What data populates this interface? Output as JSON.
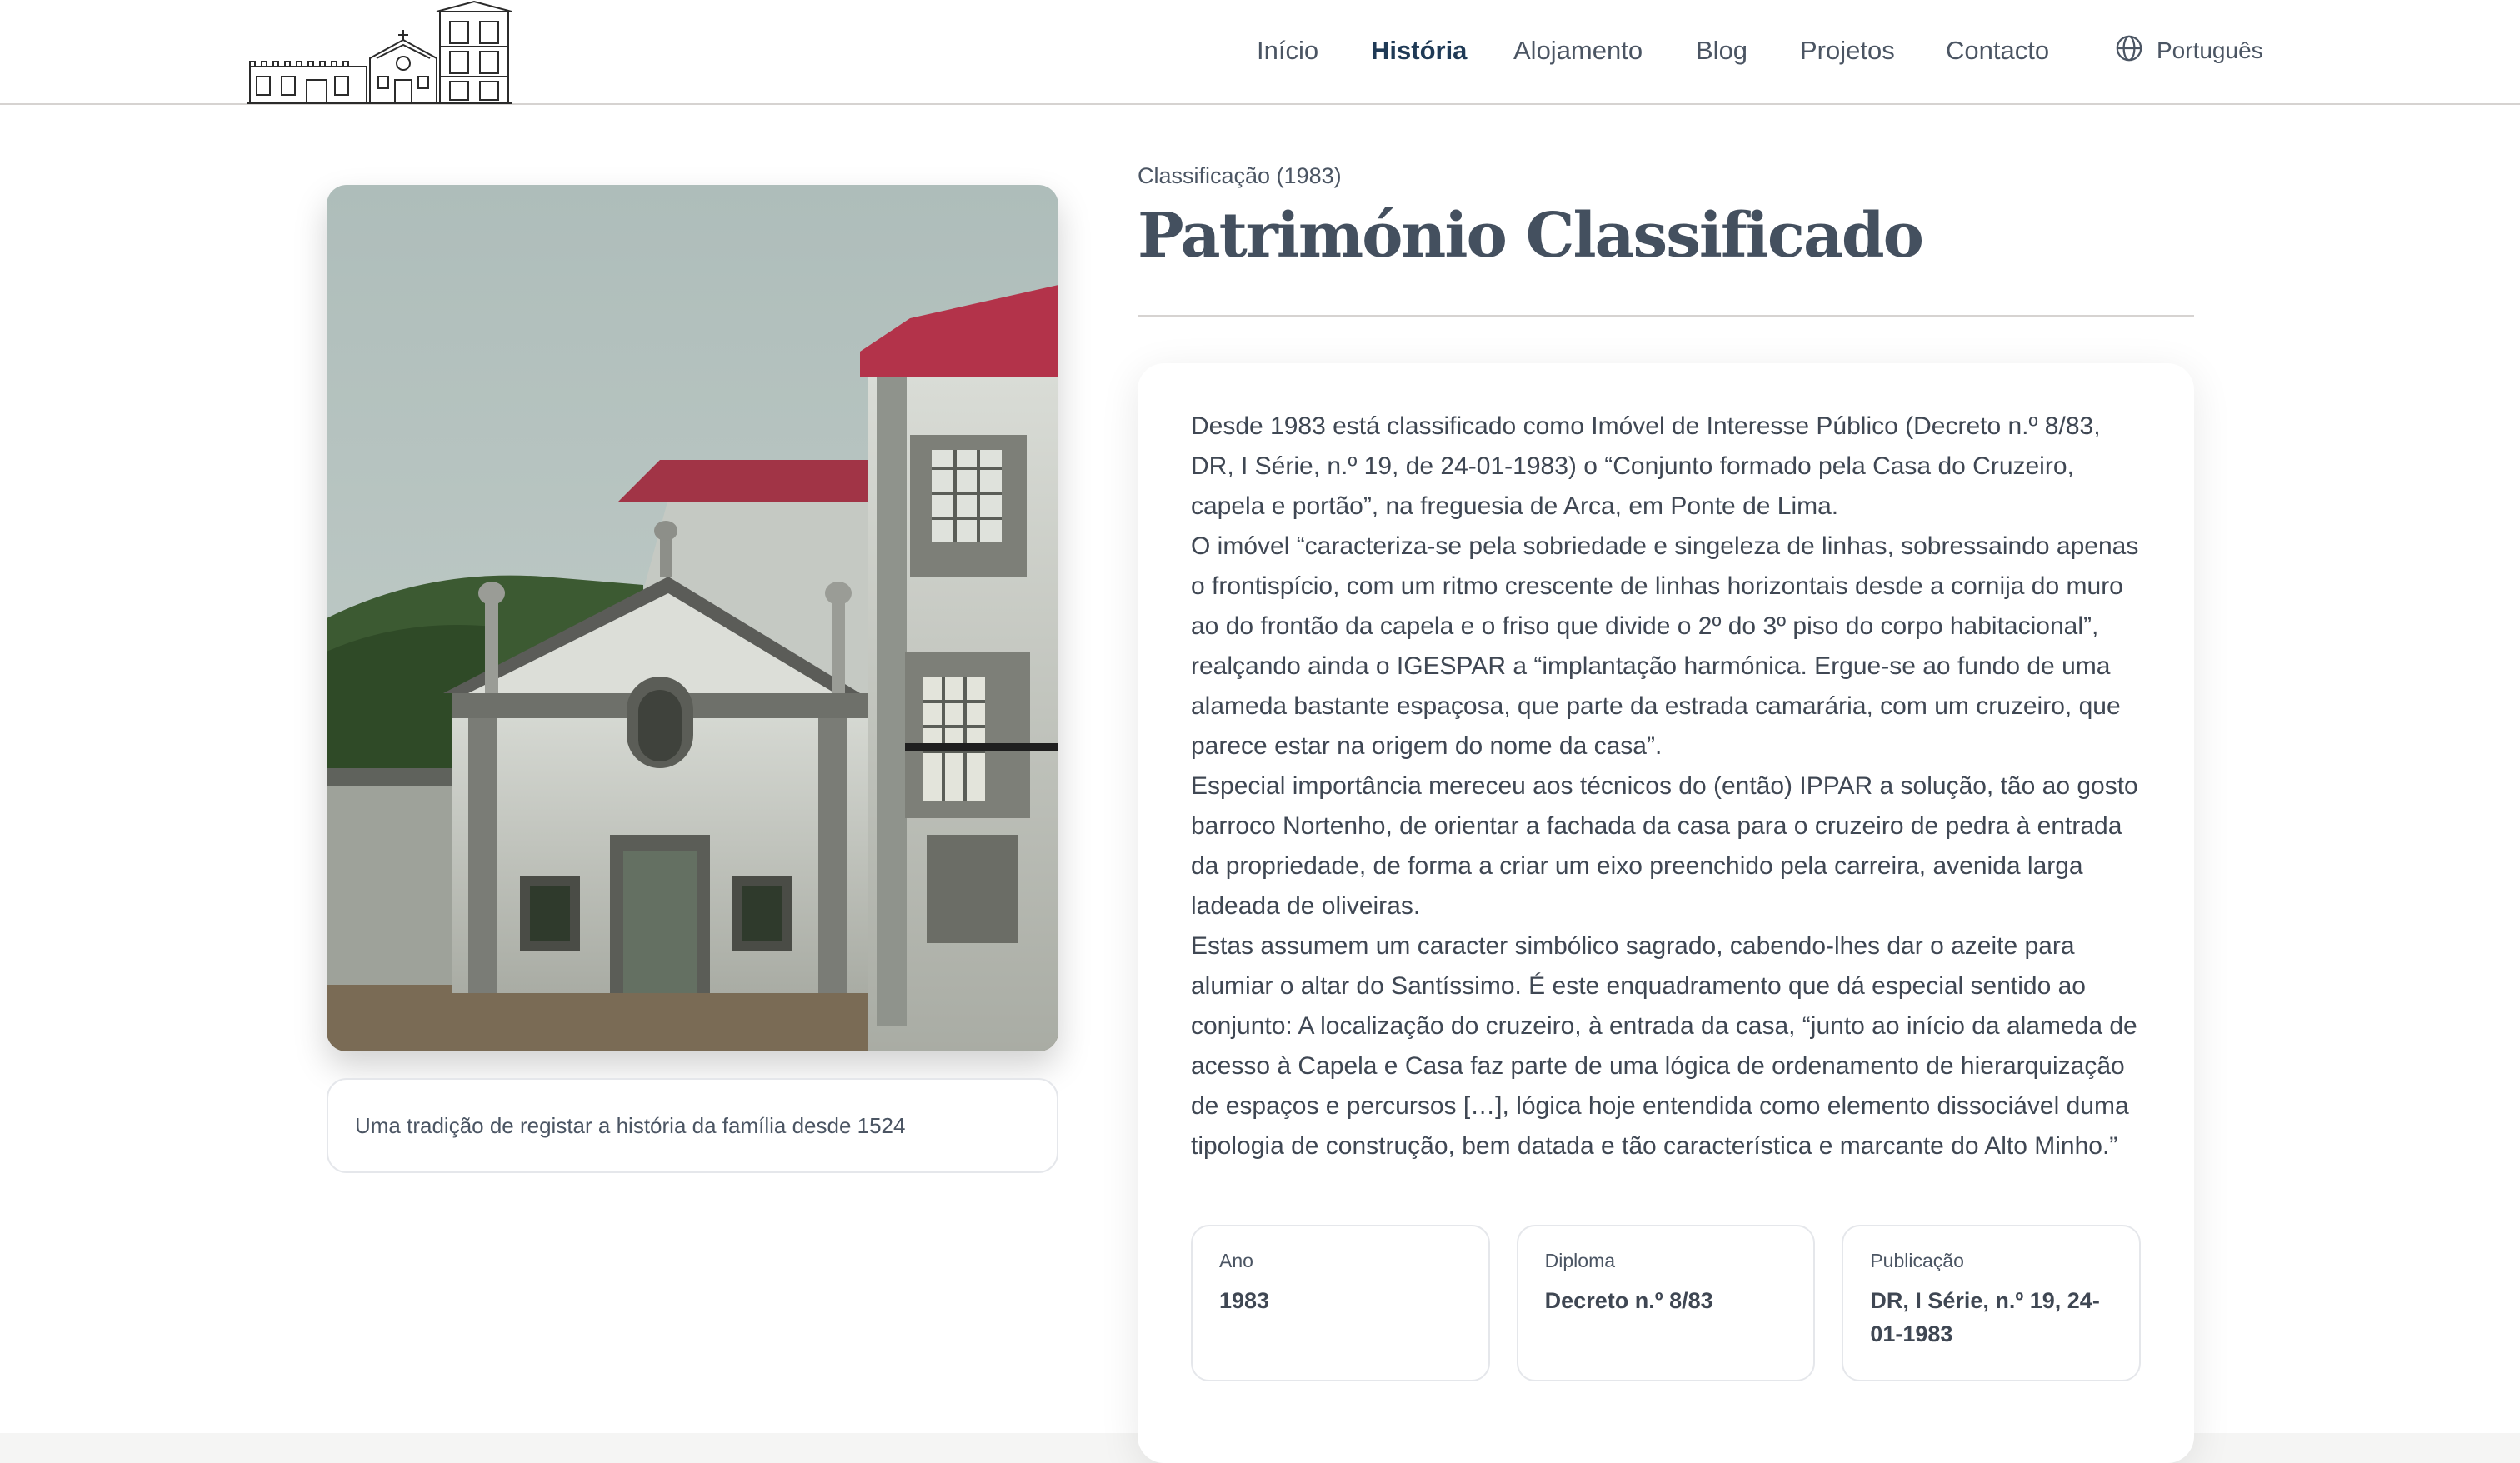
{
  "nav": {
    "items": [
      {
        "label": "Início"
      },
      {
        "label": "História",
        "active": true
      },
      {
        "label": "Alojamento"
      },
      {
        "label": "Blog"
      },
      {
        "label": "Projetos"
      },
      {
        "label": "Contacto"
      }
    ],
    "language": {
      "label": "Português",
      "icon": "globe-icon"
    }
  },
  "logo": {
    "icon": "casa-do-cruzeiro-logo"
  },
  "hero": {
    "photo_icon": "historic-chapel-photo",
    "caption": "Uma tradição de registar a história da família desde 1524"
  },
  "section": {
    "eyebrow": "Classificação (1983)",
    "title": "Património Classificado",
    "paragraphs": [
      "Desde 1983 está classificado como Imóvel de Interesse Público (Decreto n.º 8/83, DR, I Série, n.º 19, de 24-01-1983) o “Conjunto formado pela Casa do Cruzeiro, capela e portão”, na freguesia de Arca, em Ponte de Lima.",
      "O imóvel “caracteriza-se pela sobriedade e singeleza de linhas, sobressaindo apenas o frontispício, com um ritmo crescente de linhas horizontais desde a cornija do muro ao do frontão da capela e o friso que divide o 2º do 3º piso do corpo habitacional”, realçando ainda o IGESPAR a “implantação harmónica. Ergue-se ao fundo de uma alameda bastante espaçosa, que parte da estrada camarária, com um cruzeiro, que parece estar na origem do nome da casa”.",
      "Especial importância mereceu aos técnicos do (então) IPPAR a solução, tão ao gosto barroco Nortenho, de orientar a fachada da casa para o cruzeiro de pedra à entrada da propriedade, de forma a criar um eixo preenchido pela carreira, avenida larga ladeada de oliveiras.",
      "Estas assumem um caracter simbólico sagrado, cabendo-lhes dar o azeite para alumiar o altar do Santíssimo. É este enquadramento que dá especial sentido ao conjunto: A localização do cruzeiro, à entrada da casa, “junto ao início da alameda de acesso à Capela e Casa faz parte de uma lógica de ordenamento de hierarquização de espaços e percursos […], lógica hoje entendida como elemento dissociável duma tipologia de construção, bem datada e tão característica e marcante do Alto Minho.”"
    ],
    "facts": [
      {
        "label": "Ano",
        "value": "1983"
      },
      {
        "label": "Diploma",
        "value": "Decreto n.º 8/83"
      },
      {
        "label": "Publicação",
        "value": "DR, I Série, n.º 19, 24-01-1983"
      }
    ]
  },
  "colors": {
    "accent": "#1f3a56",
    "text": "#3f4753",
    "border": "#e5e7eb"
  }
}
